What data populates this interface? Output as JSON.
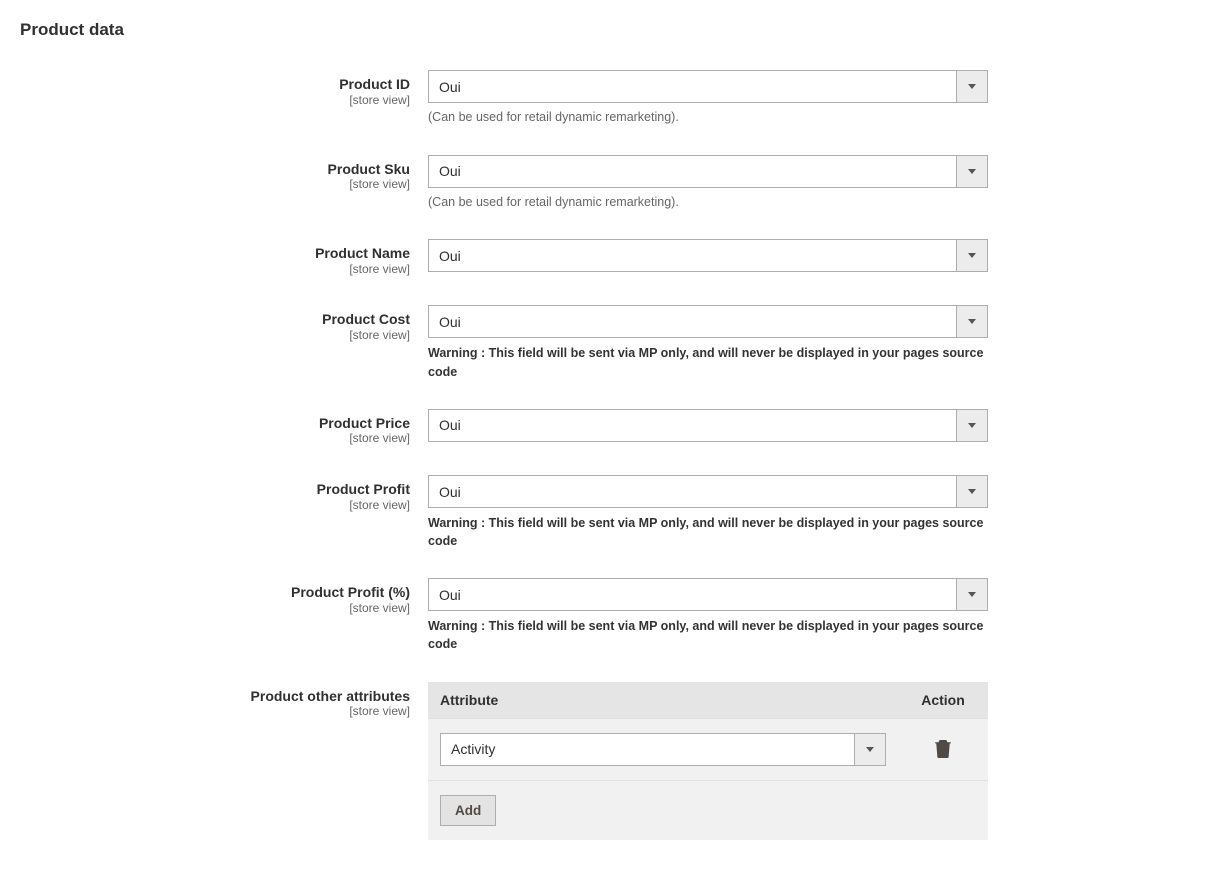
{
  "section_title": "Product data",
  "scope_label": "[store view]",
  "fields": {
    "product_id": {
      "label": "Product ID",
      "value": "Oui",
      "help": "(Can be used for retail dynamic remarketing)."
    },
    "product_sku": {
      "label": "Product Sku",
      "value": "Oui",
      "help": "(Can be used for retail dynamic remarketing)."
    },
    "product_name": {
      "label": "Product Name",
      "value": "Oui"
    },
    "product_cost": {
      "label": "Product Cost",
      "value": "Oui",
      "warning": "Warning : This field will be sent via MP only, and will never be displayed in your pages source code"
    },
    "product_price": {
      "label": "Product Price",
      "value": "Oui"
    },
    "product_profit": {
      "label": "Product Profit",
      "value": "Oui",
      "warning": "Warning : This field will be sent via MP only, and will never be displayed in your pages source code"
    },
    "product_profit_pct": {
      "label": "Product Profit (%)",
      "value": "Oui",
      "warning": "Warning : This field will be sent via MP only, and will never be displayed in your pages source code"
    },
    "other_attributes": {
      "label": "Product other attributes"
    }
  },
  "attributes_table": {
    "col_attribute": "Attribute",
    "col_action": "Action",
    "rows": [
      {
        "value": "Activity"
      }
    ],
    "add_label": "Add"
  }
}
